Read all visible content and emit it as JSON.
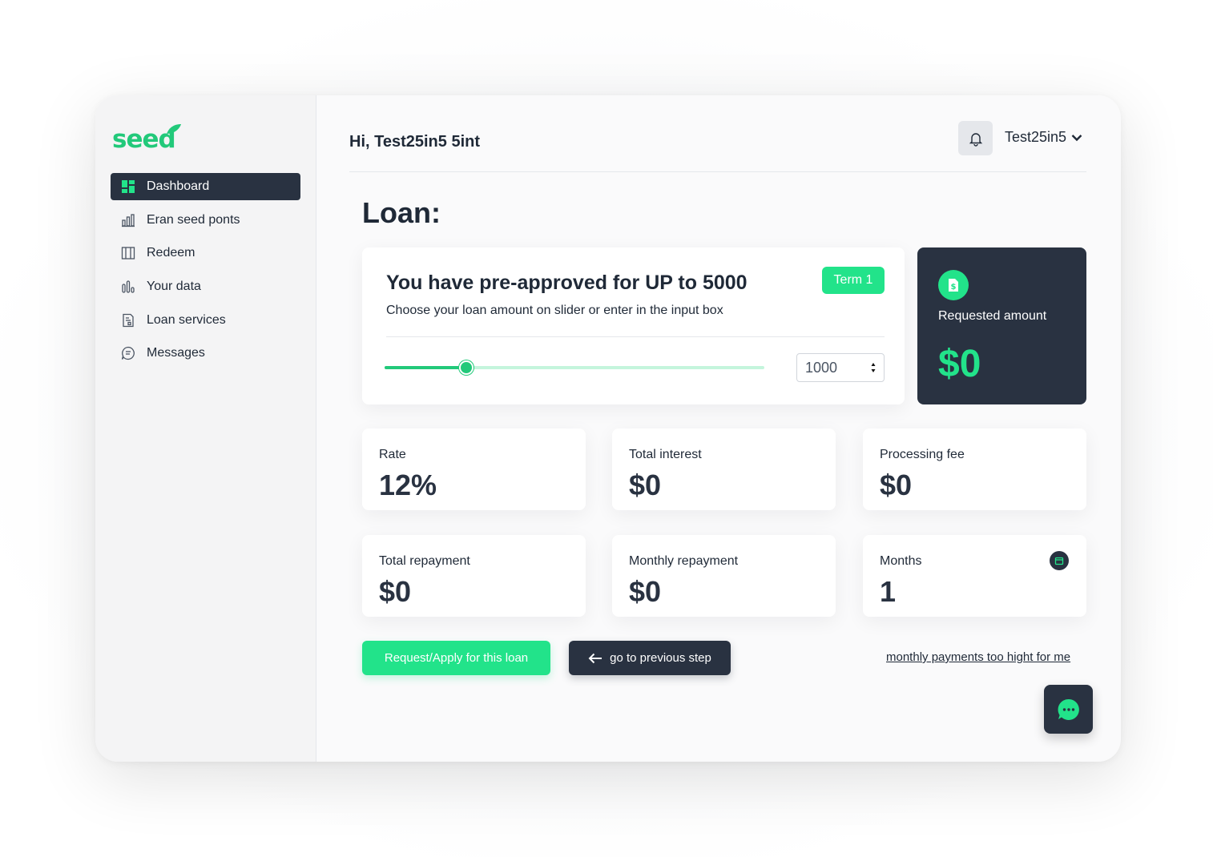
{
  "app": {
    "logo_text": "seed"
  },
  "sidebar": {
    "items": [
      {
        "label": "Dashboard",
        "icon": "dashboard-icon",
        "active": true
      },
      {
        "label": "Eran seed ponts",
        "icon": "bar-chart-icon"
      },
      {
        "label": "Redeem",
        "icon": "columns-icon"
      },
      {
        "label": "Your data",
        "icon": "data-chart-icon"
      },
      {
        "label": "Loan services",
        "icon": "document-icon"
      },
      {
        "label": "Messages",
        "icon": "message-icon"
      }
    ]
  },
  "header": {
    "greeting": "Hi, Test25in5 5int",
    "username": "Test25in5"
  },
  "page": {
    "title": "Loan:"
  },
  "approval": {
    "title": "You have pre-approved for UP to 5000",
    "subtitle": "Choose your loan amount on slider or enter in the input box",
    "term_badge": "Term 1",
    "slider_fraction": 0.215,
    "input_value": "1000"
  },
  "requested": {
    "label": "Requested amount",
    "value": "$0"
  },
  "stats": [
    {
      "label": "Rate",
      "value": "12%"
    },
    {
      "label": "Total interest",
      "value": "$0"
    },
    {
      "label": "Processing fee",
      "value": "$0"
    },
    {
      "label": "Total repayment",
      "value": "$0"
    },
    {
      "label": "Monthly repayment",
      "value": "$0"
    },
    {
      "label": "Months",
      "value": "1"
    }
  ],
  "actions": {
    "apply_label": "Request/Apply for this loan",
    "back_label": "go to previous step",
    "too_high_label": "monthly payments too hight for me"
  },
  "colors": {
    "accent": "#22e38a",
    "dark": "#293241"
  }
}
